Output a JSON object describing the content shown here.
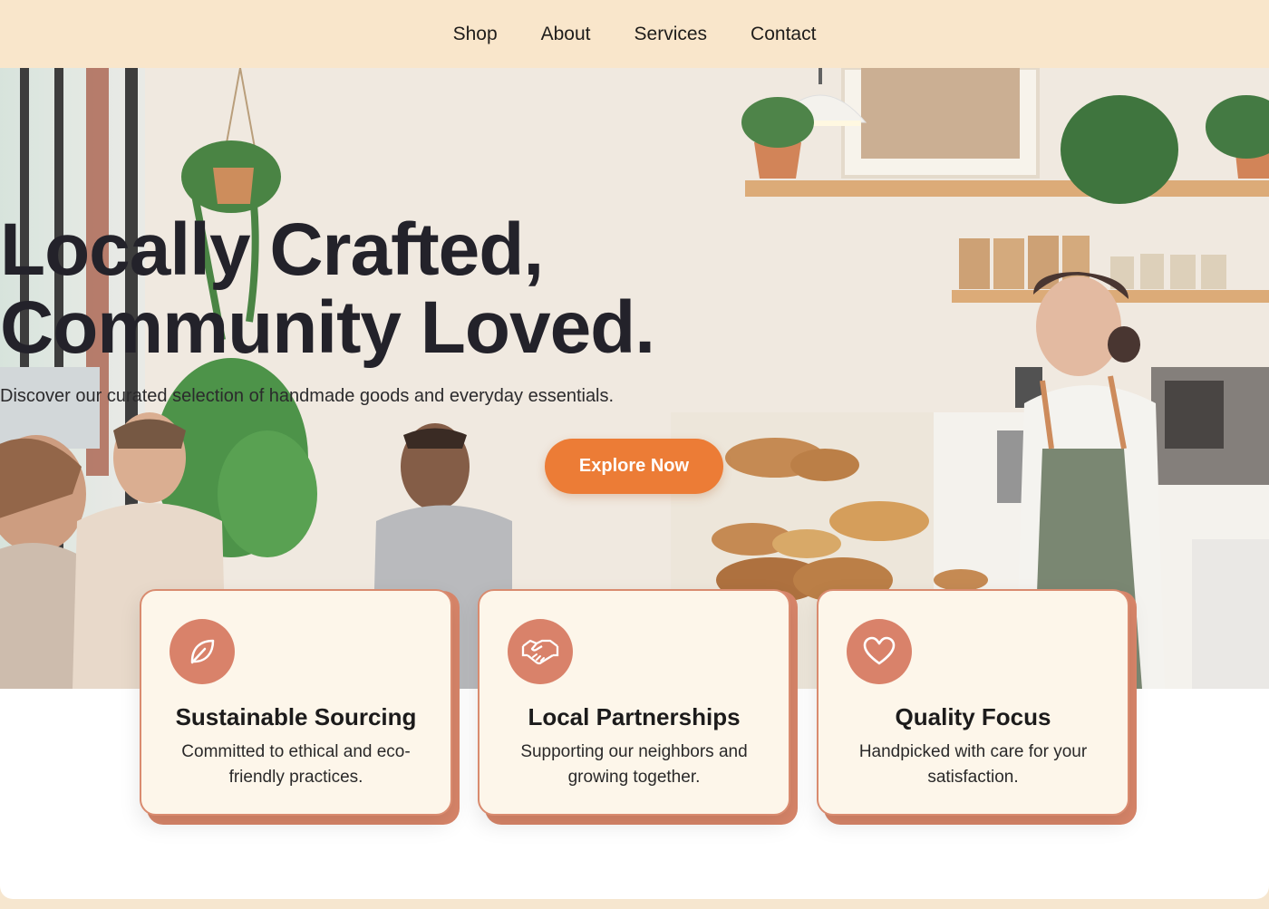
{
  "nav": {
    "items": [
      {
        "label": "Shop"
      },
      {
        "label": "About"
      },
      {
        "label": "Services"
      },
      {
        "label": "Contact"
      }
    ]
  },
  "hero": {
    "title_line1": "Locally Crafted,",
    "title_line2": "Community Loved.",
    "subtitle": "Discover our curated selection of handmade goods and everyday essentials.",
    "cta_label": "Explore Now"
  },
  "features": [
    {
      "icon": "leaf-icon",
      "title": "Sustainable Sourcing",
      "text": "Committed to ethical and eco-friendly practices."
    },
    {
      "icon": "handshake-icon",
      "title": "Local Partnerships",
      "text": "Supporting our neighbors and growing together."
    },
    {
      "icon": "heart-icon",
      "title": "Quality Focus",
      "text": "Handpicked with care for your satisfaction."
    }
  ],
  "colors": {
    "nav_bg": "#f9e6cb",
    "accent": "#ec7c36",
    "card_bg": "#fdf6ea",
    "card_border": "#d98b6f",
    "icon_circle": "#d9826a"
  }
}
